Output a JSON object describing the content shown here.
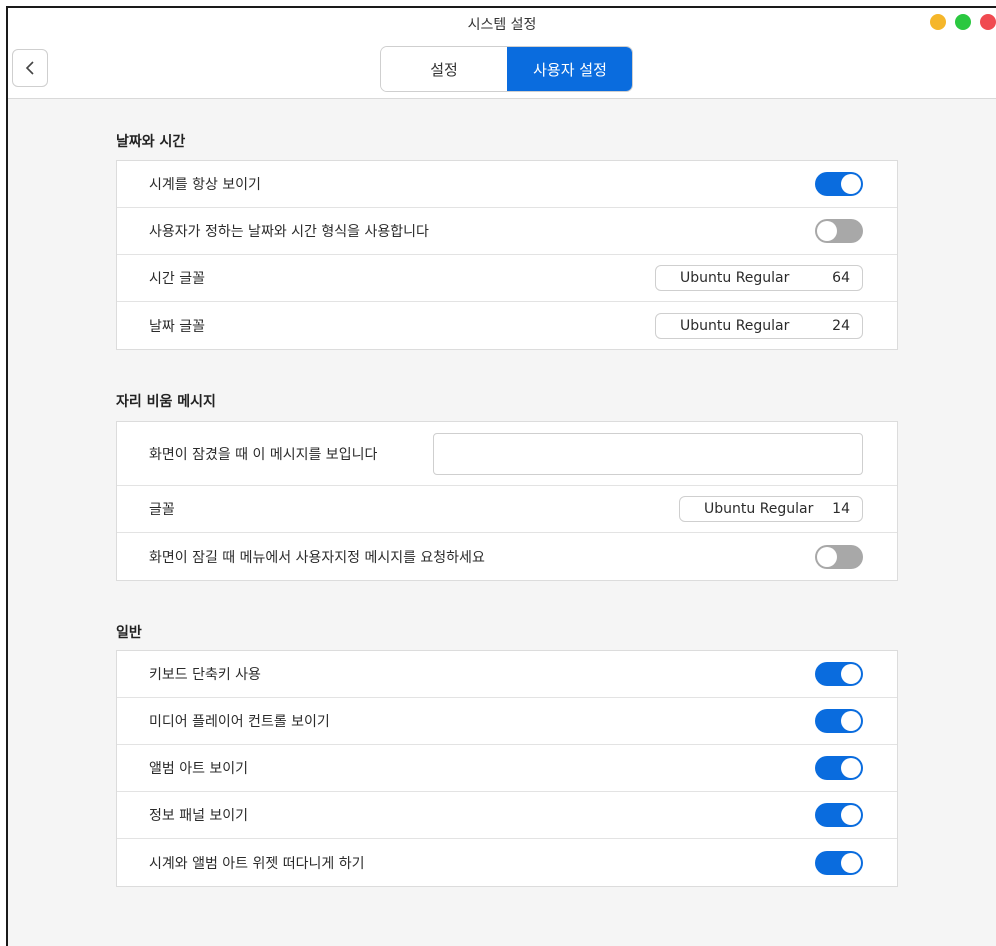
{
  "window": {
    "title": "시스템 설정"
  },
  "colors": {
    "accent": "#0a6cde",
    "toggle_off": "#a8a8a8",
    "dot_yellow": "#f5b62a",
    "dot_green": "#2bc840",
    "dot_red": "#f04a50"
  },
  "tabs": [
    {
      "label": "설정",
      "active": false
    },
    {
      "label": "사용자 설정",
      "active": true
    }
  ],
  "sections": {
    "datetime": {
      "title": "날짜와 시간",
      "show_clock": {
        "label": "시계를 항상 보이기",
        "on": true
      },
      "custom_format": {
        "label": "사용자가 정하는 날짜와 시간 형식을 사용합니다",
        "on": false
      },
      "time_font": {
        "label": "시간 글꼴",
        "font": "Ubuntu Regular",
        "size": "64"
      },
      "date_font": {
        "label": "날짜 글꼴",
        "font": "Ubuntu Regular",
        "size": "24"
      }
    },
    "away": {
      "title": "자리 비움 메시지",
      "message": {
        "label": "화면이 잠겼을 때 이 메시지를 보입니다",
        "value": "",
        "placeholder": ""
      },
      "font": {
        "label": "글꼴",
        "font": "Ubuntu Regular",
        "size": "14"
      },
      "ask_message": {
        "label": "화면이 잠길 때 메뉴에서 사용자지정 메시지를 요청하세요",
        "on": false
      }
    },
    "general": {
      "title": "일반",
      "keyboard_shortcuts": {
        "label": "키보드 단축키 사용",
        "on": true
      },
      "media_controls": {
        "label": "미디어 플레이어 컨트롤 보이기",
        "on": true
      },
      "album_art": {
        "label": "앨범 아트 보이기",
        "on": true
      },
      "info_panel": {
        "label": "정보 패널 보이기",
        "on": true
      },
      "floating_widgets": {
        "label": "시계와 앨범 아트 위젯 떠다니게 하기",
        "on": true
      }
    }
  }
}
